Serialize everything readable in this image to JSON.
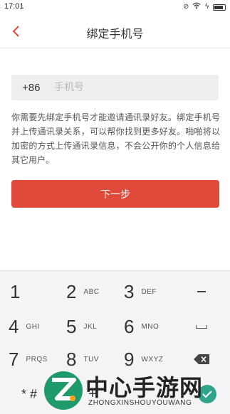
{
  "status_bar": {
    "time": "17:01"
  },
  "header": {
    "title": "绑定手机号"
  },
  "form": {
    "country_code": "+86",
    "phone_placeholder": "手机号",
    "description": "你需要先绑定手机号才能邀请通讯录好友。绑定手机号并上传通讯录关系，可以帮你找到更多好友。啪啪将以加密的方式上传通讯录信息，不会公开你的个人信息给其它用户。",
    "next_label": "下一步"
  },
  "keypad": {
    "keys": [
      {
        "num": "1",
        "letters": ""
      },
      {
        "num": "2",
        "letters": "ABC"
      },
      {
        "num": "3",
        "letters": "DEF"
      },
      {
        "num": "4",
        "letters": "GHI"
      },
      {
        "num": "5",
        "letters": "JKL"
      },
      {
        "num": "6",
        "letters": "MNO"
      },
      {
        "num": "7",
        "letters": "PRQS"
      },
      {
        "num": "8",
        "letters": "TUV"
      },
      {
        "num": "9",
        "letters": "WXYZ"
      },
      {
        "num": "* #",
        "letters": ""
      },
      {
        "num": "0",
        "letters": "+"
      }
    ],
    "icons": [
      "dash-icon",
      "space-icon",
      "backspace-icon",
      "done-icon"
    ]
  },
  "watermark": {
    "title": "中心手游网",
    "subtitle": "ZHONGXINSHOUYOUWANG"
  },
  "colors": {
    "accent": "#e04a3b",
    "back_arrow": "#e04a3b",
    "input_bg": "#eeeeee",
    "keypad_bg": "#f4f4f6"
  }
}
